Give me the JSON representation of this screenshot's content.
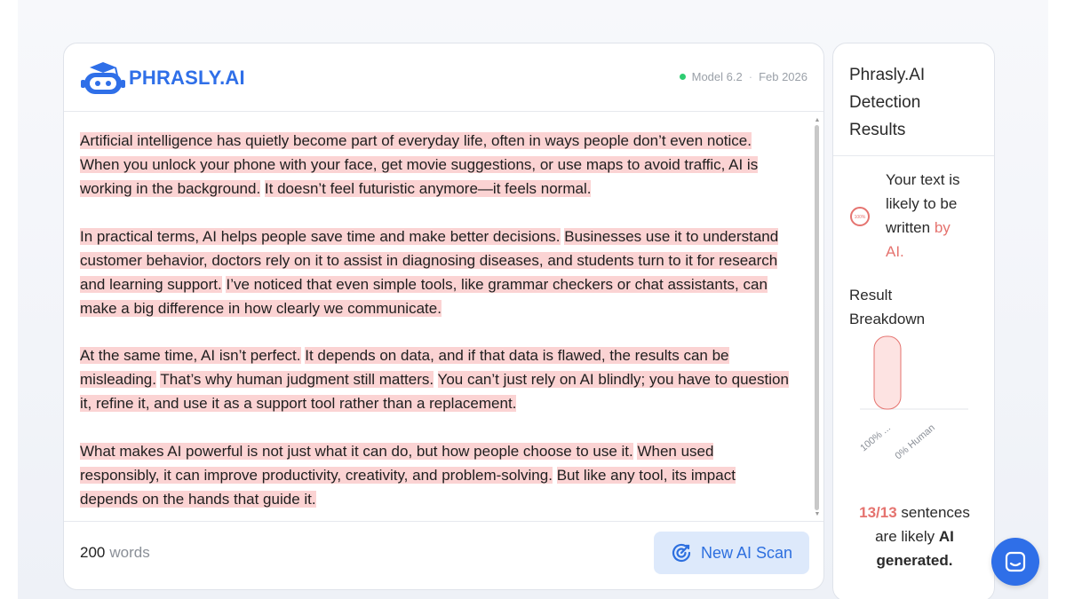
{
  "app": {
    "logo_text": "PHRASLY.AI",
    "model_label": "Model 6.2",
    "separator": "·",
    "date_label": "Feb 2026",
    "status_color": "#2ecc71"
  },
  "document": {
    "paragraphs": [
      [
        "Artificial intelligence has quietly become part of everyday life, often in ways people don’t even notice.",
        "When you unlock your phone with your face, get movie suggestions, or use maps to avoid traffic, AI is working in the background.",
        "It doesn’t feel futuristic anymore—it feels normal."
      ],
      [
        "In practical terms, AI helps people save time and make better decisions.",
        "Businesses use it to understand customer behavior, doctors rely on it to assist in diagnosing diseases, and students turn to it for research and learning support.",
        "I’ve noticed that even simple tools, like grammar checkers or chat assistants, can make a big difference in how clearly we communicate."
      ],
      [
        "At the same time, AI isn’t perfect.",
        "It depends on data, and if that data is flawed, the results can be misleading.",
        "That’s why human judgment still matters.",
        "You can’t just rely on AI blindly; you have to question it, refine it, and use it as a support tool rather than a replacement."
      ],
      [
        "What makes AI powerful is not just what it can do, but how people choose to use it.",
        "When used responsibly, it can improve productivity, creativity, and problem-solving.",
        "But like any tool, its impact depends on the hands that guide it."
      ]
    ],
    "highlight_color": "#fbd3d3"
  },
  "footer": {
    "word_count": "200",
    "word_label": "words",
    "scan_button_label": "New AI Scan"
  },
  "sidebar": {
    "title_lines": [
      "Phrasly.AI",
      "Detection",
      "Results"
    ],
    "gauge_label": "100%",
    "verdict_lines": [
      "Your text is",
      "likely to be"
    ],
    "verdict_written": "written",
    "verdict_by": "by",
    "verdict_ai": "AI.",
    "breakdown_lines": [
      "Result",
      "Breakdown"
    ],
    "result_ratio": "13/13",
    "result_sentences": "sentences",
    "result_are_likely": "are likely",
    "result_ai": "AI",
    "result_generated": "generated.",
    "accent_color": "#e5736f"
  },
  "chart_data": {
    "type": "bar",
    "categories": [
      "100% ...",
      "0% Human"
    ],
    "values": [
      100,
      0
    ],
    "ylim": [
      0,
      100
    ],
    "colors": [
      "#e5736f",
      "#cfd3da"
    ]
  }
}
